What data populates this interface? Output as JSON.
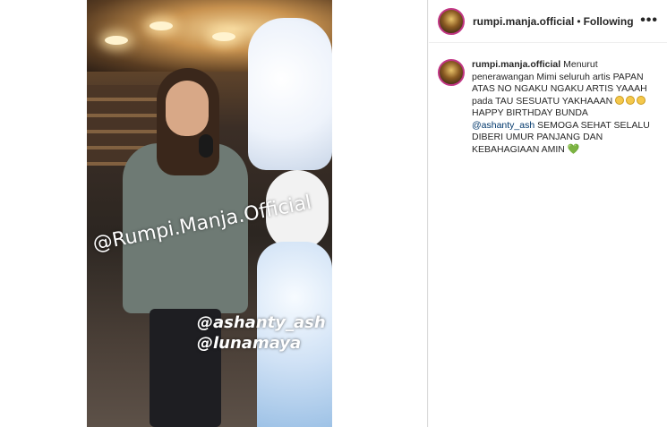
{
  "post": {
    "username": "rumpi.manja.official",
    "separator": "•",
    "follow_status": "Following",
    "more_icon": "•••"
  },
  "media": {
    "watermark": "@Rumpi.Manja.Official",
    "tags": [
      "@ashanty_ash",
      "@lunamaya"
    ]
  },
  "caption": {
    "username": "rumpi.manja.official",
    "text_1": "Menurut penerawangan Mimi seluruh artis PAPAN ATAS NO NGAKU NGAKU ARTIS YAAAH pada TAU SESUATU YAKHAAAN",
    "emojis": [
      "laughing-face",
      "laughing-face",
      "laughing-face"
    ],
    "line_2": "HAPPY BIRTHDAY BUNDA",
    "mention": "@ashanty_ash",
    "text_3": "SEMOGA SEHAT SELALU DIBERI UMUR PANJANG DAN KEBAHAGIAAN AMIN",
    "heart_icon": "green-heart",
    "heart": "💚"
  },
  "colors": {
    "story_ring": "#c13584",
    "mention": "#00376b",
    "heart": "#2e9d3a"
  }
}
